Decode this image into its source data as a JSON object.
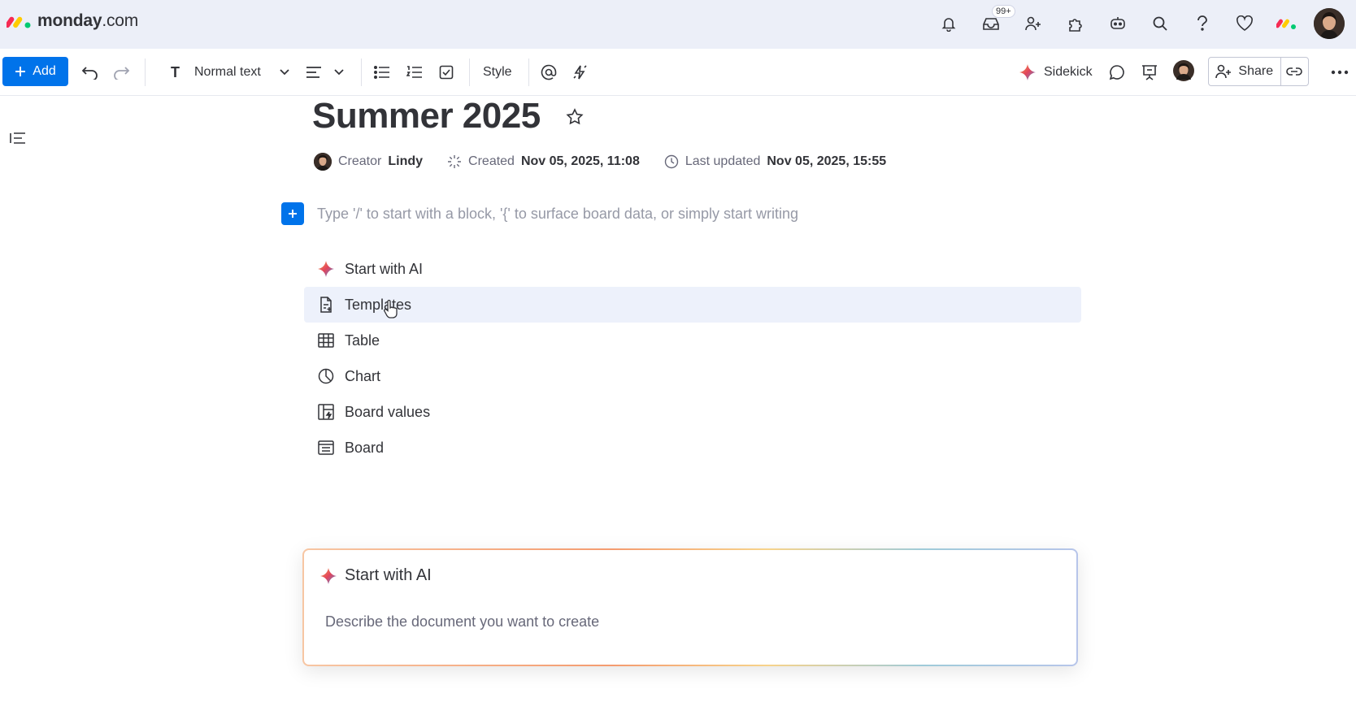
{
  "app": {
    "logo_bold": "monday",
    "logo_suffix": ".com",
    "inbox_badge": "99+"
  },
  "toolbar": {
    "add_label": "Add",
    "text_style": "Normal text",
    "style_label": "Style",
    "sidekick_label": "Sidekick",
    "share_label": "Share"
  },
  "doc": {
    "title": "Summer 2025",
    "creator_label": "Creator",
    "creator_name": "Lindy",
    "created_label": "Created",
    "created_value": "Nov 05, 2025, 11:08",
    "updated_label": "Last updated",
    "updated_value": "Nov 05, 2025, 15:55",
    "placeholder": "Type '/' to start with a block, '{' to surface board data, or simply start writing"
  },
  "menu": {
    "items": [
      {
        "label": "Start with AI",
        "icon": "sparkle-icon"
      },
      {
        "label": "Templates",
        "icon": "template-icon"
      },
      {
        "label": "Table",
        "icon": "table-icon"
      },
      {
        "label": "Chart",
        "icon": "chart-icon"
      },
      {
        "label": "Board values",
        "icon": "board-values-icon"
      },
      {
        "label": "Board",
        "icon": "board-icon"
      }
    ]
  },
  "ai_card": {
    "title": "Start with AI",
    "input_placeholder": "Describe the document you want to create"
  },
  "colors": {
    "primary": "#0073ea",
    "topbar_bg": "#eceff8",
    "highlight_bg": "#edf1fb",
    "text": "#323338",
    "muted": "#676879"
  }
}
